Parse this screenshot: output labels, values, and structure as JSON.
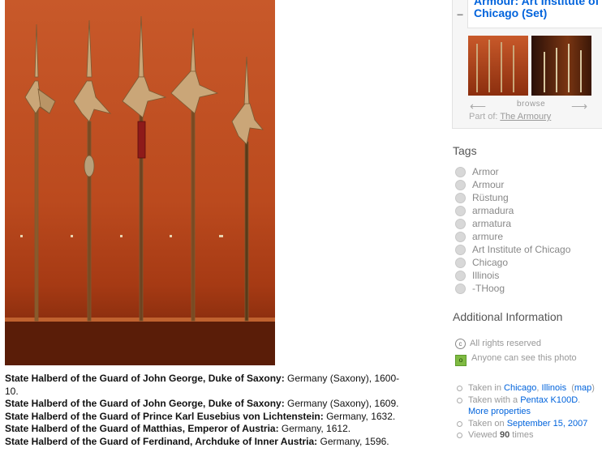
{
  "photo": {
    "alt_label": ""
  },
  "captions": [
    {
      "title": "State Halberd of the Guard of John George, Duke of Saxony:",
      "text": " Germany (Saxony), 1600-10."
    },
    {
      "title": "State Halberd of the Guard of John George, Duke of Saxony:",
      "text": " Germany (Saxony), 1609."
    },
    {
      "title": "State Halberd of the Guard of Prince Karl Eusebius von Lichtenstein:",
      "text": " Germany, 1632."
    },
    {
      "title": "State Halberd of the Guard of Matthias, Emperor of Austria:",
      "text": " Germany, 1612."
    },
    {
      "title": "State Halberd of the Guard of Ferdinand, Archduke of Inner Austria:",
      "text": " Germany, 1596."
    }
  ],
  "set": {
    "toggle": "−",
    "title": "Armour: Art Institute of Chicago (Set)",
    "browse": "browse",
    "part_of_label": "Part of:",
    "part_of_link": "The Armoury"
  },
  "tags": {
    "heading": "Tags",
    "items": [
      "Armor",
      "Armour",
      "Rüstung",
      "armadura",
      "armatura",
      "armure",
      "Art Institute of Chicago",
      "Chicago",
      "Illinois",
      "-THoog"
    ]
  },
  "additional": {
    "heading": "Additional Information",
    "rights": "All rights reserved",
    "visibility": "Anyone can see this photo",
    "taken_in_label": "Taken in",
    "city": "Chicago",
    "state": "Illinois",
    "map": "map",
    "taken_with_label": "Taken with a",
    "camera": "Pentax K100D",
    "more_properties": "More properties",
    "taken_on_label": "Taken on",
    "date": "September 15, 2007",
    "viewed_prefix": "Viewed",
    "views": "90",
    "viewed_suffix": "times"
  }
}
